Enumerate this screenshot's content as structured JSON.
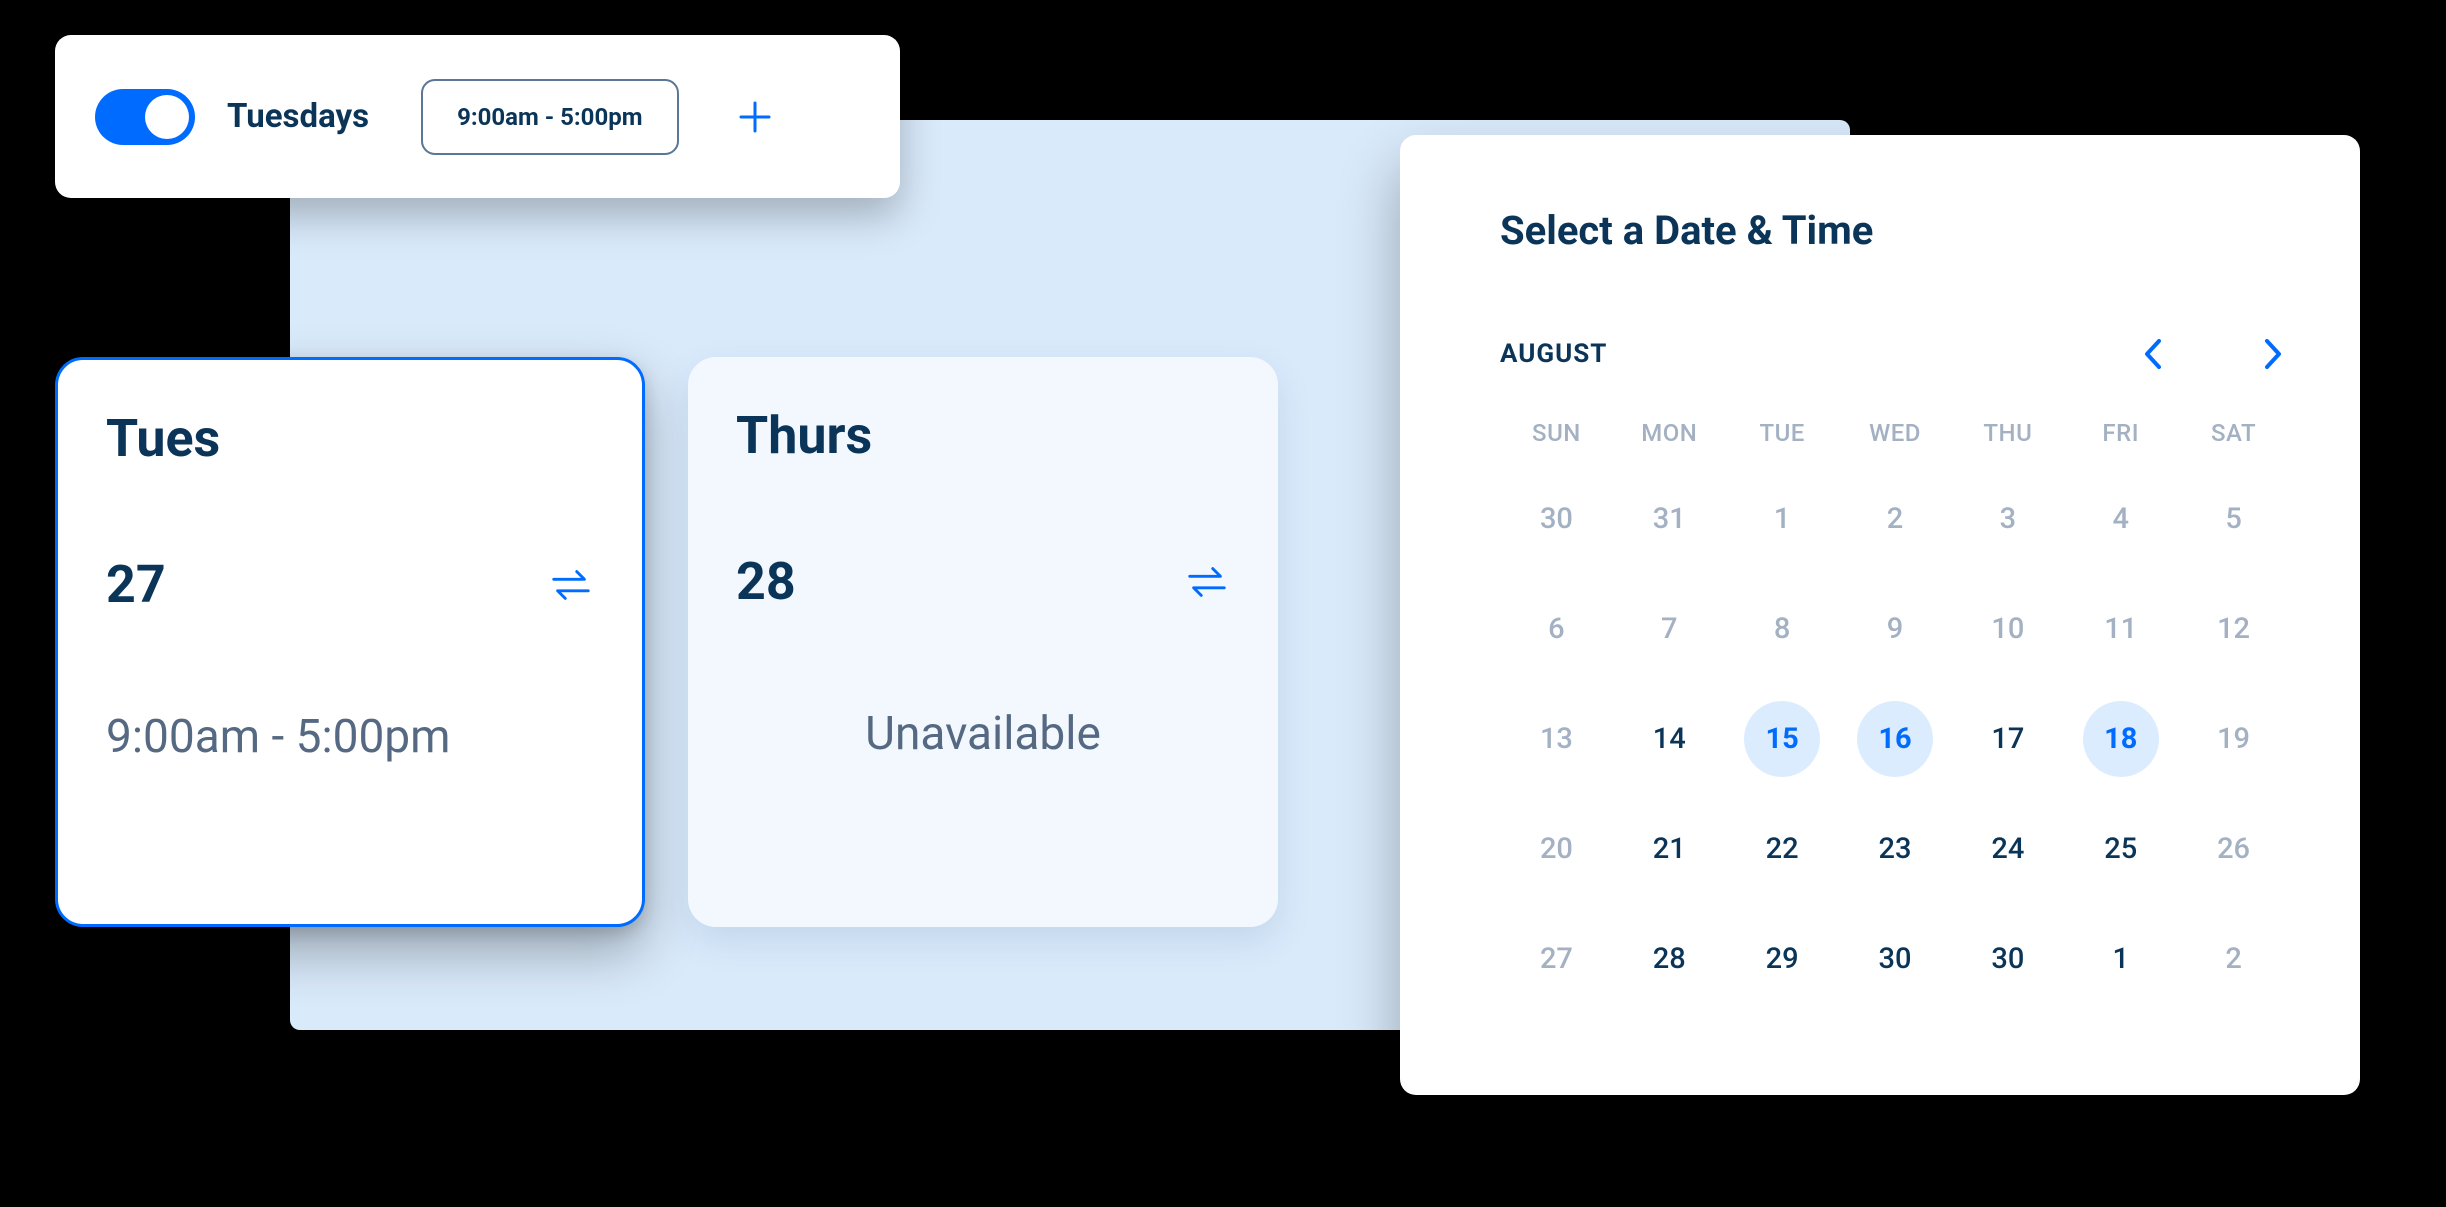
{
  "colors": {
    "accent": "#006BFF",
    "navy": "#0B3558",
    "muted": "#A3B1C2",
    "pale_blue_bg": "#D9EAFB",
    "card_pale": "#F3F8FF"
  },
  "toggle_row": {
    "enabled": true,
    "day_label": "Tuesdays",
    "time_range": "9:00am - 5:00pm",
    "add_icon": "plus-icon"
  },
  "day_cards": {
    "tues": {
      "name": "Tues",
      "number": "27",
      "repeat_icon": "repeat-icon",
      "availability": "9:00am - 5:00pm"
    },
    "thurs": {
      "name": "Thurs",
      "number": "28",
      "repeat_icon": "repeat-icon",
      "availability": "Unavailable"
    }
  },
  "calendar": {
    "title": "Select a Date & Time",
    "month": "AUGUST",
    "dow": [
      "SUN",
      "MON",
      "TUE",
      "WED",
      "THU",
      "FRI",
      "SAT"
    ],
    "weeks": [
      [
        {
          "n": "30",
          "muted": true
        },
        {
          "n": "31",
          "muted": true
        },
        {
          "n": "1",
          "muted": true
        },
        {
          "n": "2",
          "muted": true
        },
        {
          "n": "3",
          "muted": true
        },
        {
          "n": "4",
          "muted": true
        },
        {
          "n": "5",
          "muted": true
        }
      ],
      [
        {
          "n": "6",
          "muted": true
        },
        {
          "n": "7",
          "muted": true
        },
        {
          "n": "8",
          "muted": true
        },
        {
          "n": "9",
          "muted": true
        },
        {
          "n": "10",
          "muted": true
        },
        {
          "n": "11",
          "muted": true
        },
        {
          "n": "12",
          "muted": true
        }
      ],
      [
        {
          "n": "13",
          "muted": true
        },
        {
          "n": "14"
        },
        {
          "n": "15",
          "selected": true
        },
        {
          "n": "16",
          "selected": true
        },
        {
          "n": "17"
        },
        {
          "n": "18",
          "selected": true
        },
        {
          "n": "19",
          "muted": true
        }
      ],
      [
        {
          "n": "20",
          "muted": true
        },
        {
          "n": "21"
        },
        {
          "n": "22"
        },
        {
          "n": "23"
        },
        {
          "n": "24"
        },
        {
          "n": "25"
        },
        {
          "n": "26",
          "muted": true
        }
      ],
      [
        {
          "n": "27",
          "muted": true
        },
        {
          "n": "28"
        },
        {
          "n": "29"
        },
        {
          "n": "30"
        },
        {
          "n": "30"
        },
        {
          "n": "1"
        },
        {
          "n": "2",
          "muted": true
        }
      ]
    ]
  }
}
